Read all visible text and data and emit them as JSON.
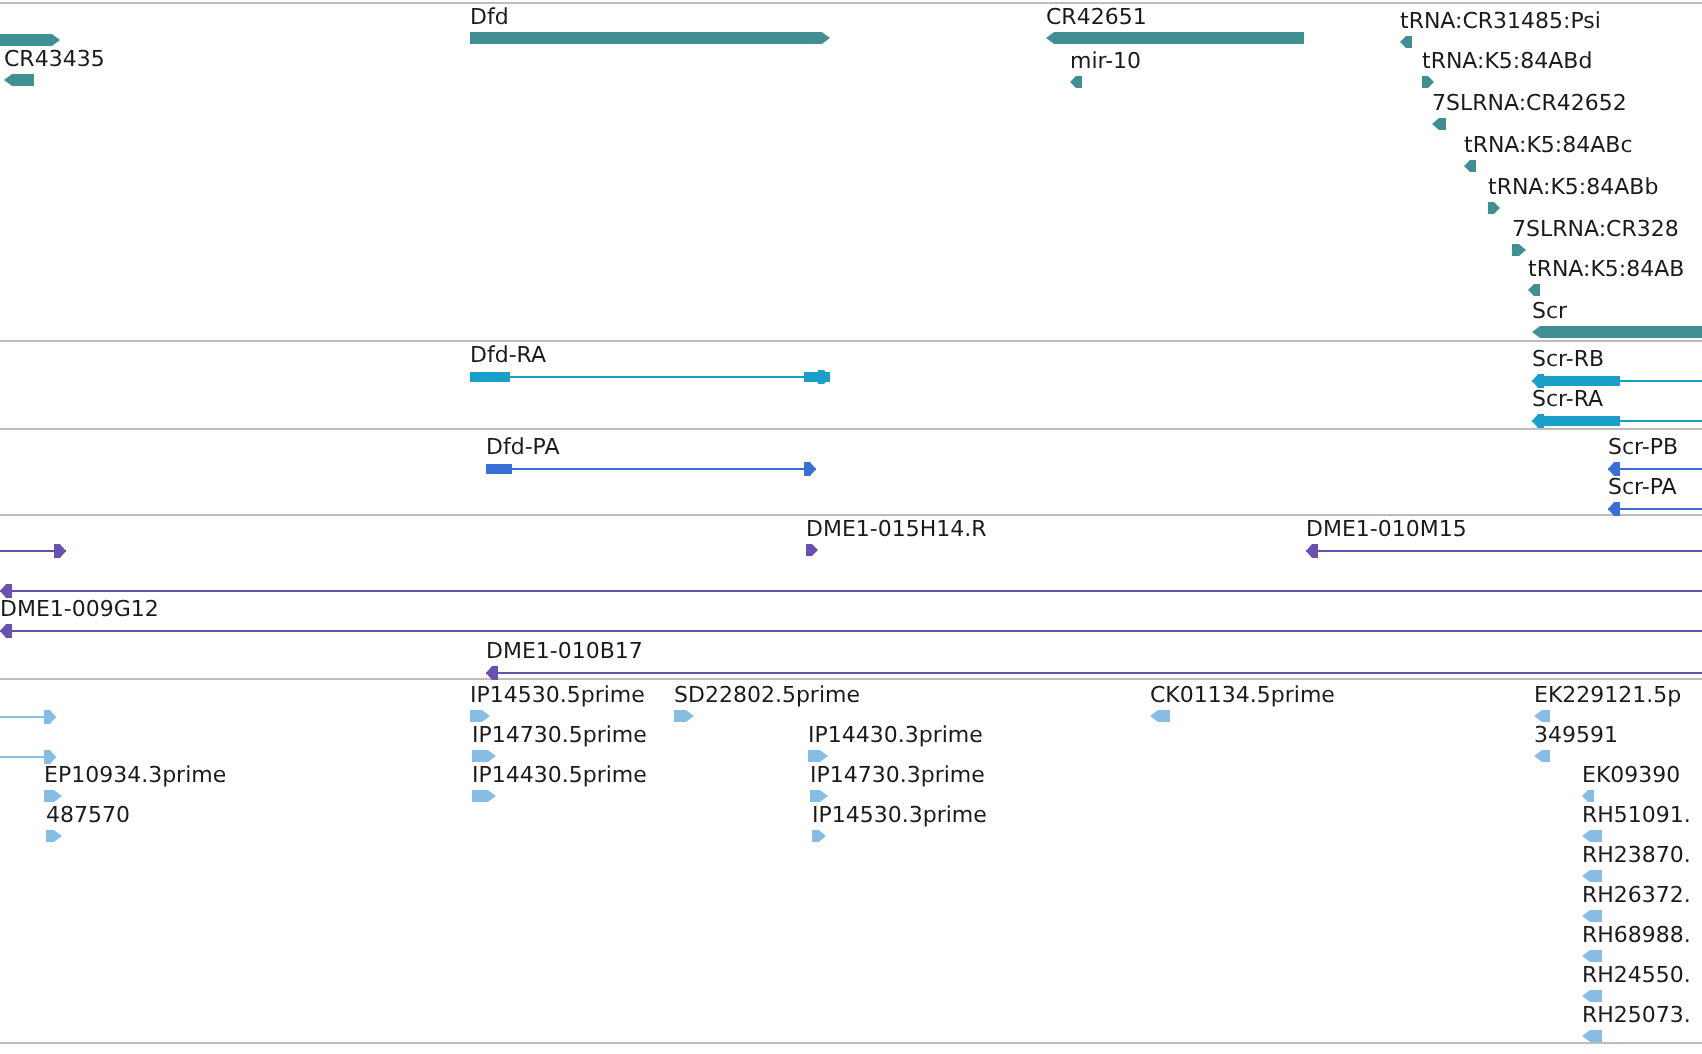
{
  "tracks": [
    {
      "kind": "gene",
      "features": [
        {
          "kind": "block",
          "reverse": false
        },
        {
          "kind": "block",
          "reverse": true,
          "label": "CR43435"
        },
        {
          "kind": "block",
          "reverse": false,
          "label": "Dfd"
        },
        {
          "kind": "block",
          "reverse": true,
          "label": "CR42651"
        },
        {
          "kind": "glyph",
          "reverse": true,
          "label": "mir-10"
        },
        {
          "kind": "glyph",
          "reverse": true,
          "label": "tRNA:CR31485:Psi"
        },
        {
          "kind": "glyph",
          "reverse": false,
          "label": "tRNA:K5:84ABd"
        },
        {
          "kind": "glyph",
          "reverse": true,
          "label": "7SLRNA:CR42652"
        },
        {
          "kind": "glyph",
          "reverse": true,
          "label": "tRNA:K5:84ABc"
        },
        {
          "kind": "glyph",
          "reverse": false,
          "label": "tRNA:K5:84ABb"
        },
        {
          "kind": "glyph",
          "reverse": false,
          "label": "7SLRNA:CR328"
        },
        {
          "kind": "glyph",
          "reverse": true,
          "label": "tRNA:K5:84AB"
        },
        {
          "kind": "block",
          "reverse": true,
          "label": "Scr"
        }
      ]
    },
    {
      "kind": "transcript",
      "features": [
        {
          "kind": "gapped",
          "reverse": false,
          "label": "Dfd-RA"
        },
        {
          "kind": "gapped",
          "reverse": true,
          "label": "Scr-RB"
        },
        {
          "kind": "gapped",
          "reverse": true,
          "label": "Scr-RA"
        }
      ]
    },
    {
      "kind": "protein",
      "features": [
        {
          "kind": "gapped",
          "reverse": false,
          "label": "Dfd-PA"
        },
        {
          "kind": "line",
          "reverse": true,
          "label": "Scr-PB"
        },
        {
          "kind": "line",
          "reverse": true,
          "label": "Scr-PA"
        }
      ]
    },
    {
      "kind": "clone",
      "features": [
        {
          "kind": "line",
          "reverse": false
        },
        {
          "kind": "glyph",
          "reverse": false,
          "label": "DME1-015H14.R"
        },
        {
          "kind": "line",
          "reverse": true,
          "label": "DME1-010M15"
        },
        {
          "kind": "line",
          "reverse": true
        },
        {
          "kind": "line",
          "reverse": true,
          "label": "DME1-009G12"
        },
        {
          "kind": "line",
          "reverse": true,
          "label": "DME1-010B17"
        }
      ]
    },
    {
      "kind": "est",
      "features": [
        {
          "kind": "line",
          "reverse": false
        },
        {
          "kind": "line",
          "reverse": false
        },
        {
          "kind": "glyph",
          "reverse": false,
          "label": "EP10934.3prime"
        },
        {
          "kind": "glyph",
          "reverse": false,
          "label": "487570"
        },
        {
          "kind": "glyph",
          "reverse": false,
          "label": "IP14530.5prime"
        },
        {
          "kind": "glyph",
          "reverse": false,
          "label": "IP14730.5prime"
        },
        {
          "kind": "glyph",
          "reverse": false,
          "label": "IP14430.5prime"
        },
        {
          "kind": "glyph",
          "reverse": false,
          "label": "SD22802.5prime"
        },
        {
          "kind": "glyph",
          "reverse": false,
          "label": "IP14430.3prime"
        },
        {
          "kind": "glyph",
          "reverse": false,
          "label": "IP14730.3prime"
        },
        {
          "kind": "glyph",
          "reverse": false,
          "label": "IP14530.3prime"
        },
        {
          "kind": "glyph",
          "reverse": true,
          "label": "CK01134.5prime"
        },
        {
          "kind": "glyph",
          "reverse": true,
          "label": "EK229121.5p"
        },
        {
          "kind": "glyph",
          "reverse": true,
          "label": "349591"
        },
        {
          "kind": "glyph",
          "reverse": true,
          "label": "EK09390"
        },
        {
          "kind": "glyph",
          "reverse": true,
          "label": "RH51091."
        },
        {
          "kind": "glyph",
          "reverse": true,
          "label": "RH23870."
        },
        {
          "kind": "glyph",
          "reverse": true,
          "label": "RH26372."
        },
        {
          "kind": "glyph",
          "reverse": true,
          "label": "RH68988."
        },
        {
          "kind": "glyph",
          "reverse": true,
          "label": "RH24550."
        },
        {
          "kind": "glyph",
          "reverse": true,
          "label": "RH25073."
        }
      ]
    }
  ]
}
